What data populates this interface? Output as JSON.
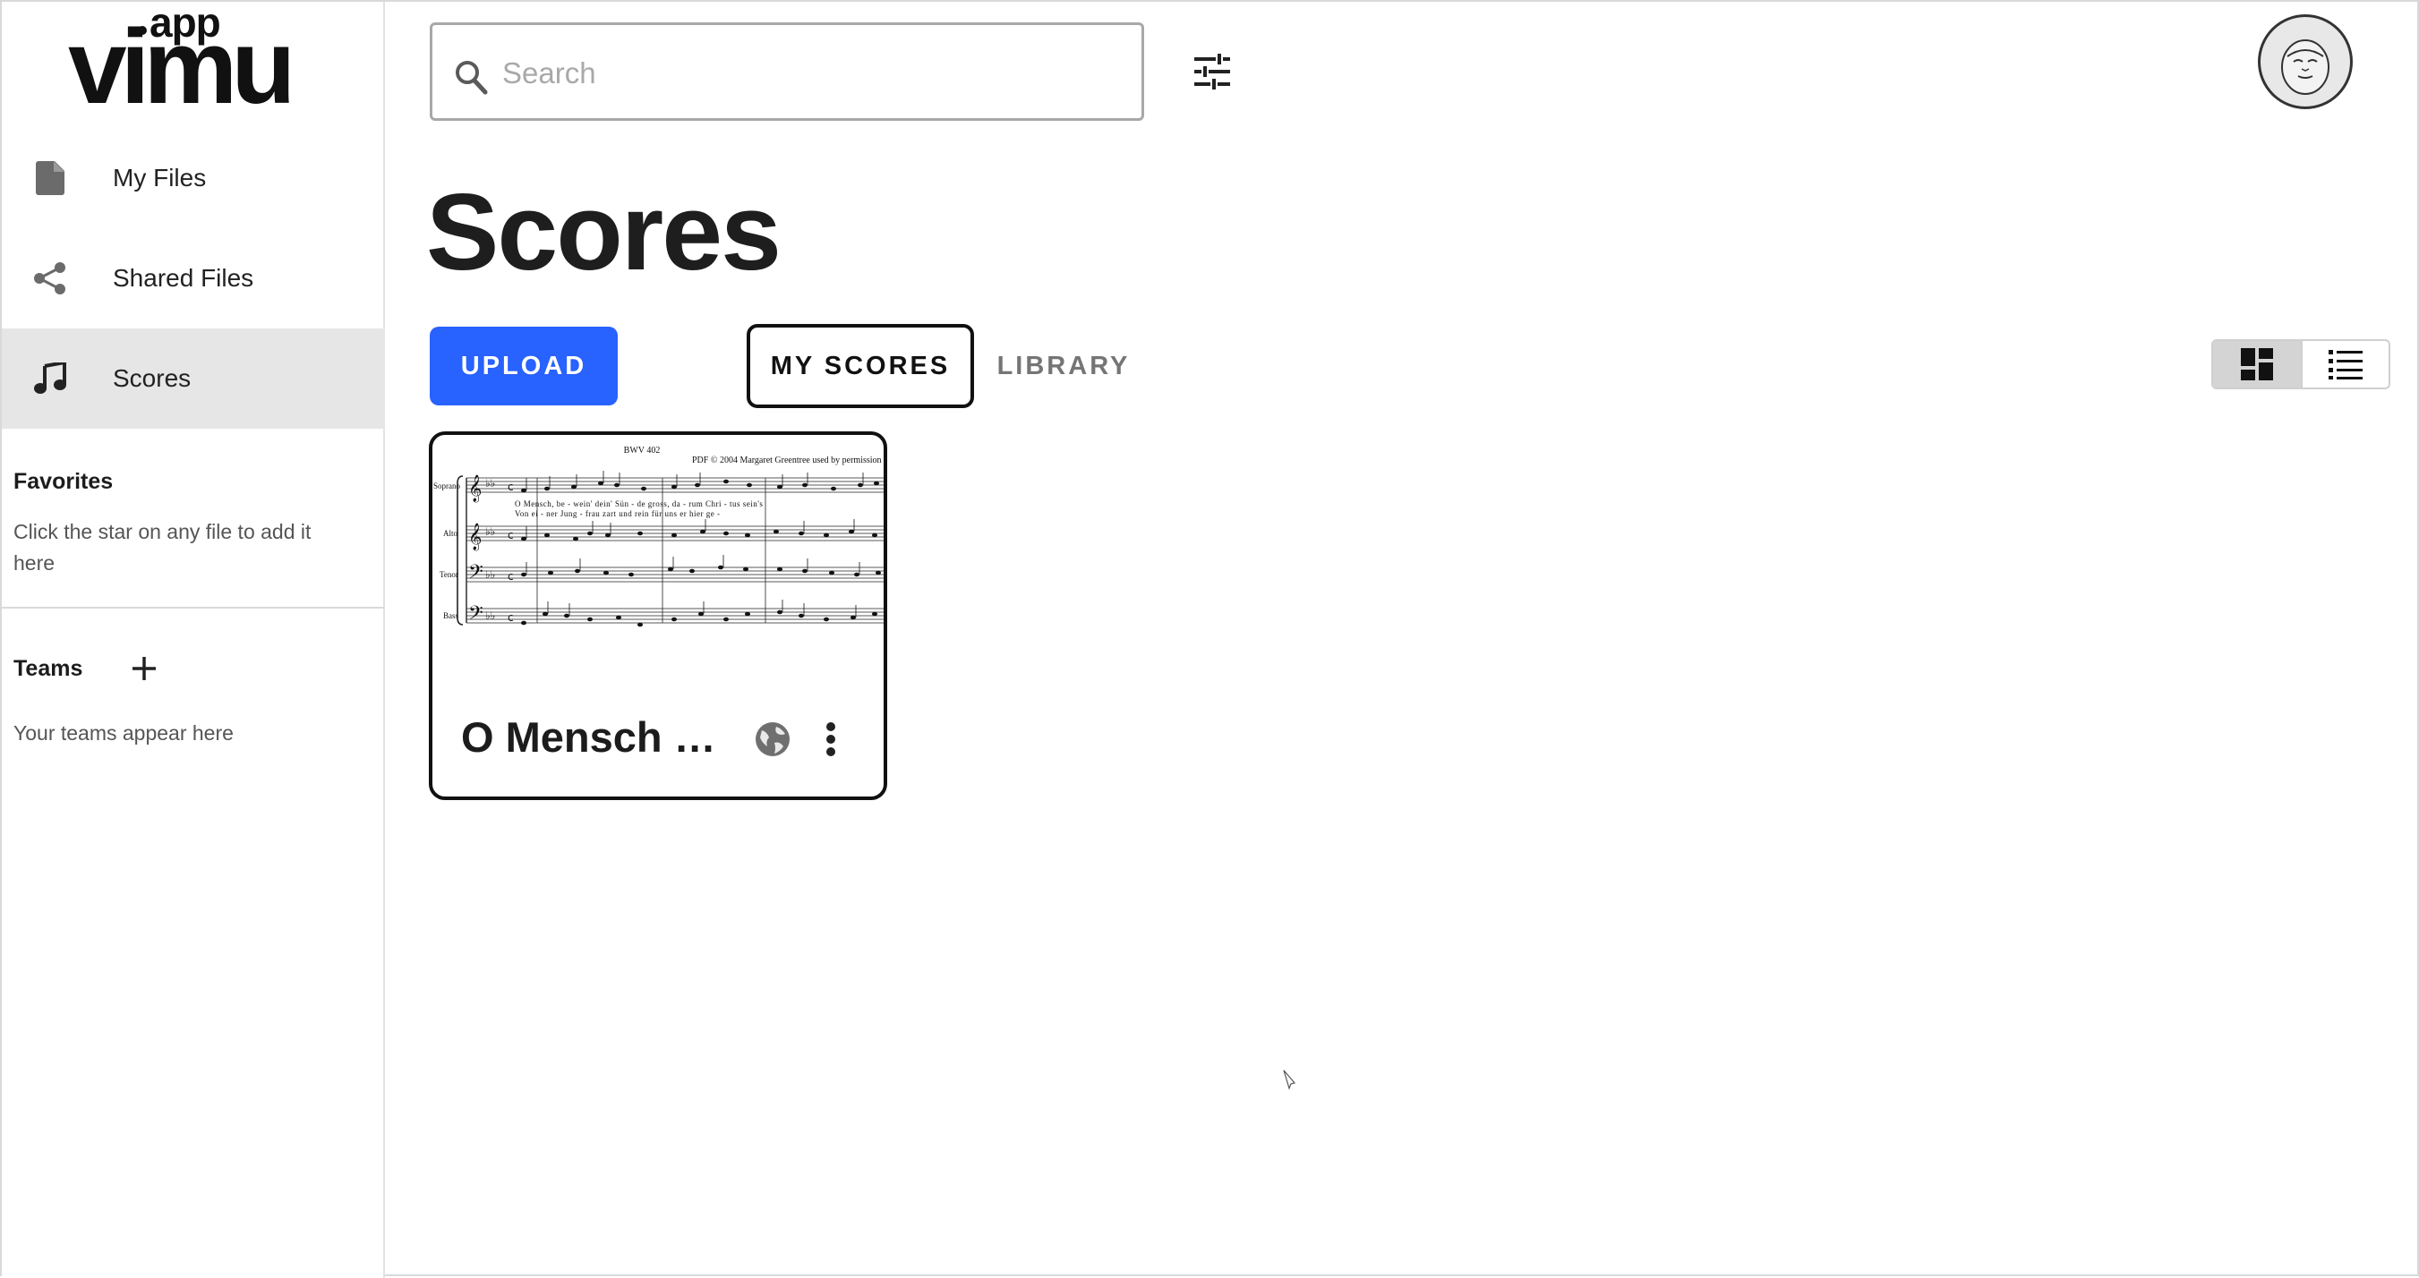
{
  "app": {
    "logo_suffix": "app",
    "logo_brand": "vimu"
  },
  "sidebar": {
    "items": [
      {
        "label": "My Files",
        "icon": "file-icon",
        "active": false
      },
      {
        "label": "Shared Files",
        "icon": "share-icon",
        "active": false
      },
      {
        "label": "Scores",
        "icon": "music-note-icon",
        "active": true
      }
    ],
    "favorites": {
      "title": "Favorites",
      "empty_text": "Click the star on any file to add it here"
    },
    "teams": {
      "title": "Teams",
      "add_icon": "plus-icon",
      "empty_text": "Your teams appear here"
    }
  },
  "header": {
    "search": {
      "placeholder": "Search",
      "value": ""
    },
    "filter_icon": "sliders-icon",
    "avatar_icon": "user-avatar"
  },
  "main": {
    "title": "Scores",
    "upload_label": "UPLOAD",
    "tabs": [
      {
        "label": "MY SCORES",
        "active": true
      },
      {
        "label": "LIBRARY",
        "active": false
      }
    ],
    "view_modes": [
      {
        "name": "grid-view-icon",
        "active": true
      },
      {
        "name": "list-view-icon",
        "active": false
      }
    ],
    "scores": [
      {
        "title": "O Mensch b...",
        "visibility_icon": "globe-icon",
        "thumbnail": {
          "catalog": "BWV 402",
          "copyright": "PDF © 2004 Margaret Greentree used by permission",
          "parts": [
            "Soprano",
            "Alto",
            "Tenor",
            "Bass"
          ],
          "lyrics_line1": [
            "O",
            "Mensch,",
            "be",
            "-",
            "wein'",
            "dein'",
            "Sün",
            "-",
            "de",
            "gross,",
            "da",
            "-",
            "rum",
            "Chri",
            "-",
            "tus",
            "sein's"
          ],
          "lyrics_line2": [
            "Von",
            "ei",
            "-",
            "ner",
            "Jung",
            "-",
            "frau",
            "zart",
            "und",
            "rein",
            "für",
            "uns",
            "er",
            "hier",
            "ge",
            "-"
          ]
        }
      }
    ]
  },
  "colors": {
    "accent": "#2862ff",
    "sidebar_active_bg": "#e6e6e6",
    "text_dark": "#1e1e1e",
    "text_muted": "#757575"
  }
}
